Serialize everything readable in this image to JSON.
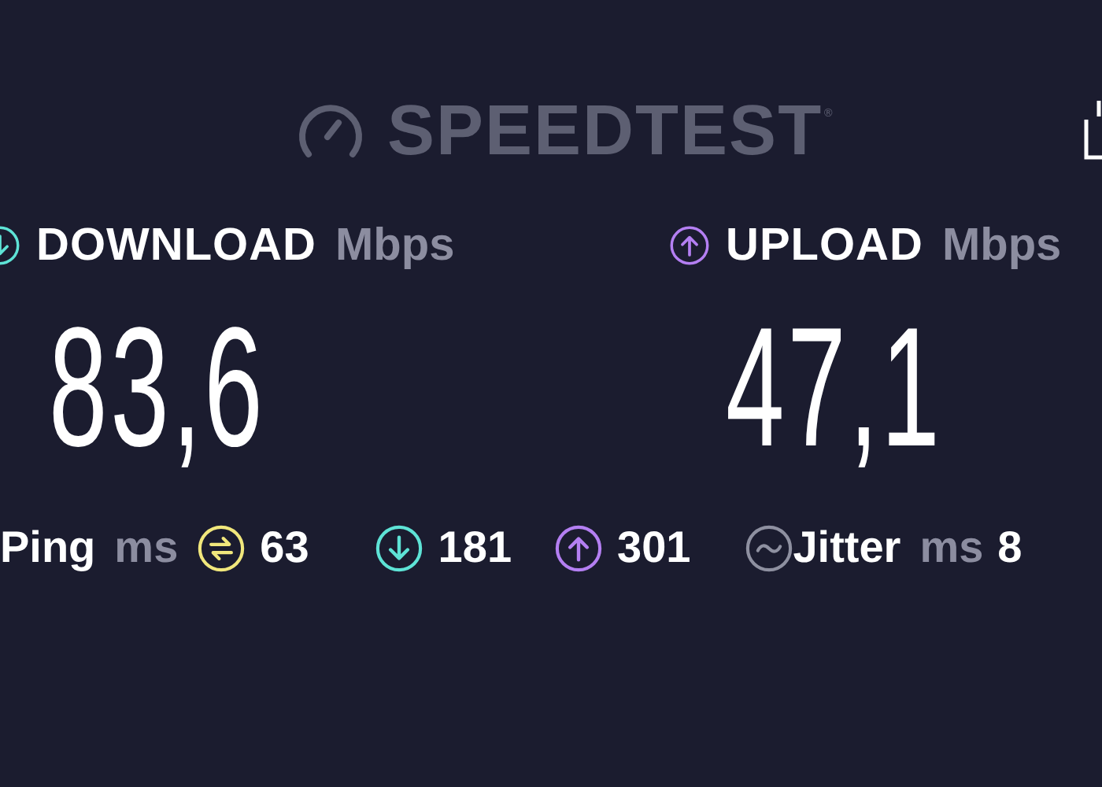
{
  "logo": {
    "text": "SPEEDTEST",
    "mark": "®"
  },
  "results": [
    {
      "kind": "download",
      "label": "DOWNLOAD",
      "unit": "Mbps",
      "value": "83,6"
    },
    {
      "kind": "upload",
      "label": "UPLOAD",
      "unit": "Mbps",
      "value": "47,1"
    }
  ],
  "ping": {
    "label": "Ping",
    "unit": "ms",
    "readings": [
      {
        "kind": "idle",
        "value": "63"
      },
      {
        "kind": "download",
        "value": "181"
      },
      {
        "kind": "upload",
        "value": "301"
      }
    ]
  },
  "jitter": {
    "label": "Jitter",
    "unit": "ms",
    "value": "8"
  }
}
